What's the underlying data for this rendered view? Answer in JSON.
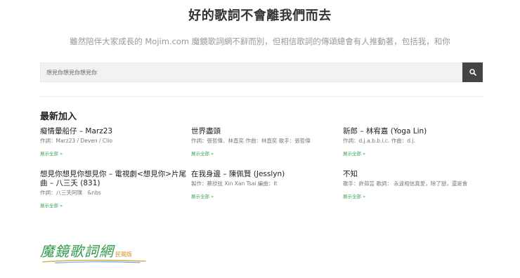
{
  "header": {
    "title": "好的歌詞不會離我們而去",
    "subtitle": "雖然陪伴大家成長的 Mojim.com 魔鏡歌詞網不辭而別，但相信歌詞的傳頌總會有人推動著，包括我，和你"
  },
  "search": {
    "placeholder": "想見你想見你想見你",
    "button_icon": "search-icon"
  },
  "latest": {
    "heading": "最新加入",
    "more_label": "展示全部 »",
    "items": [
      {
        "title": "癡情暈船仔 – Marz23",
        "meta": "作詞：Marz23 / Deven / Clio"
      },
      {
        "title": "世界盡頭",
        "meta": "作詞：張哲偉．林直奕 作曲：林直奕 歌手：張哲偉"
      },
      {
        "title": "新郎 – 林宥嘉 (Yoga Lin)",
        "meta": "作詞：d.j.a.b.b.i.c. 作曲：d.j."
      },
      {
        "title": "想見你想見你想見你 – 電視劇<想見你>片尾曲 – 八三夭 (831)",
        "meta": "作詞：八三夭阿璞　&nbs"
      },
      {
        "title": "在我身邊 – 陳佩賢 (Jesslyn)",
        "meta": "製作：蔡欣弦 Xin Xan Tsai 編曲：It"
      },
      {
        "title": "不知",
        "meta": "歌手：許茹芸 歌詞： 永遠相信真愛，除了戀，還是會"
      }
    ]
  },
  "logo": {
    "main": "魔鏡歌詞網",
    "sub": "民間版",
    "accent_color": "#2e9a4a",
    "sub_color": "#d18a2a"
  },
  "colors": {
    "link_green": "#3aa655",
    "search_button": "#444444"
  }
}
